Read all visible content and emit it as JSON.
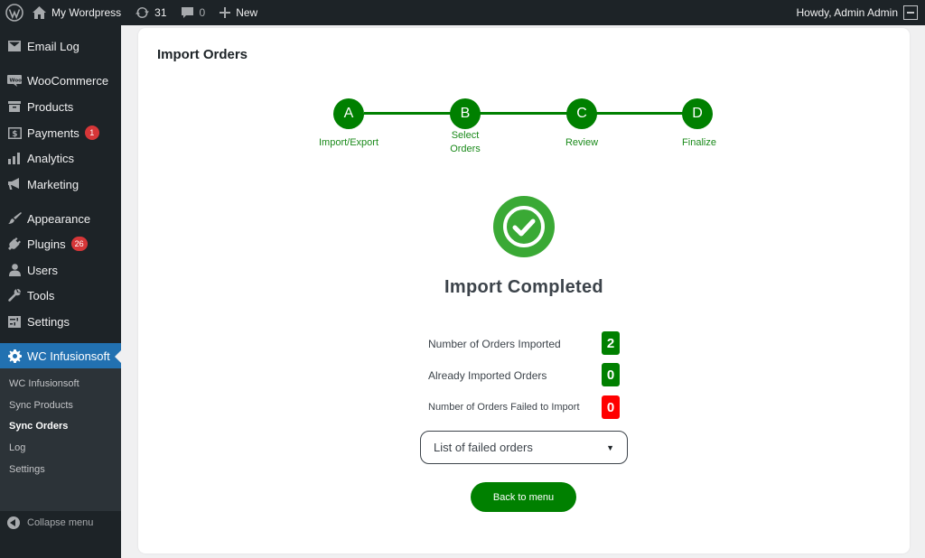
{
  "admin_bar": {
    "site_name": "My Wordpress",
    "updates_count": "31",
    "comments_count": "0",
    "new_label": "New",
    "greeting": "Howdy, Admin Admin"
  },
  "sidebar": {
    "items": [
      {
        "label": "Email Log",
        "icon": "email-icon"
      },
      {
        "label": "WooCommerce",
        "icon": "woocommerce-icon"
      },
      {
        "label": "Products",
        "icon": "archive-icon"
      },
      {
        "label": "Payments",
        "icon": "dollar-icon",
        "badge": "1"
      },
      {
        "label": "Analytics",
        "icon": "bar-chart-icon"
      },
      {
        "label": "Marketing",
        "icon": "megaphone-icon"
      },
      {
        "label": "Appearance",
        "icon": "paintbrush-icon"
      },
      {
        "label": "Plugins",
        "icon": "plug-icon",
        "badge": "26"
      },
      {
        "label": "Users",
        "icon": "user-icon"
      },
      {
        "label": "Tools",
        "icon": "wrench-icon"
      },
      {
        "label": "Settings",
        "icon": "settings-icon"
      },
      {
        "label": "WC Infusionsoft",
        "icon": "gear-icon"
      }
    ],
    "submenu": [
      "WC Infusionsoft",
      "Sync Products",
      "Sync Orders",
      "Log",
      "Settings"
    ],
    "current_submenu": "Sync Orders",
    "collapse_label": "Collapse menu"
  },
  "main": {
    "title": "Import Orders",
    "steps": [
      {
        "letter": "A",
        "label": "Import/Export"
      },
      {
        "letter": "B",
        "label": "Select Orders"
      },
      {
        "letter": "C",
        "label": "Review"
      },
      {
        "letter": "D",
        "label": "Finalize"
      }
    ],
    "status_title": "Import Completed",
    "stats": [
      {
        "label": "Number of Orders Imported",
        "value": "2",
        "color": "#008000"
      },
      {
        "label": "Already Imported Orders",
        "value": "0",
        "color": "#008000"
      },
      {
        "label": "Number of Orders Failed to Import",
        "value": "0",
        "color": "#ff0000"
      }
    ],
    "failed_select_value": "List of failed orders",
    "back_button": "Back to menu"
  },
  "colors": {
    "accent": "#008000",
    "admin_dark": "#1d2327",
    "active_menu": "#2271b1",
    "success_circle": "#3aa935",
    "error": "#ff0000"
  }
}
